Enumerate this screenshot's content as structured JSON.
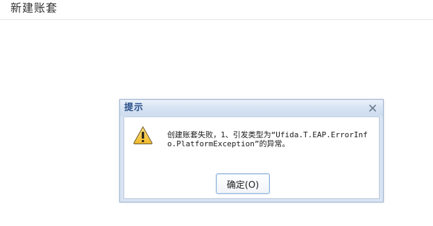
{
  "page": {
    "title": "新建账套"
  },
  "dialog": {
    "title": "提示",
    "close_icon": "close-icon",
    "warning_icon": "warning-icon",
    "message": "创建账套失败，1、引发类型为“Ufida.T.EAP.ErrorInfo.PlatformException”的异常。",
    "ok_label": "确定(O)"
  },
  "colors": {
    "dialog_title": "#2a4f88",
    "warning_fill": "#f7c948",
    "button_border": "#8ab0da"
  }
}
